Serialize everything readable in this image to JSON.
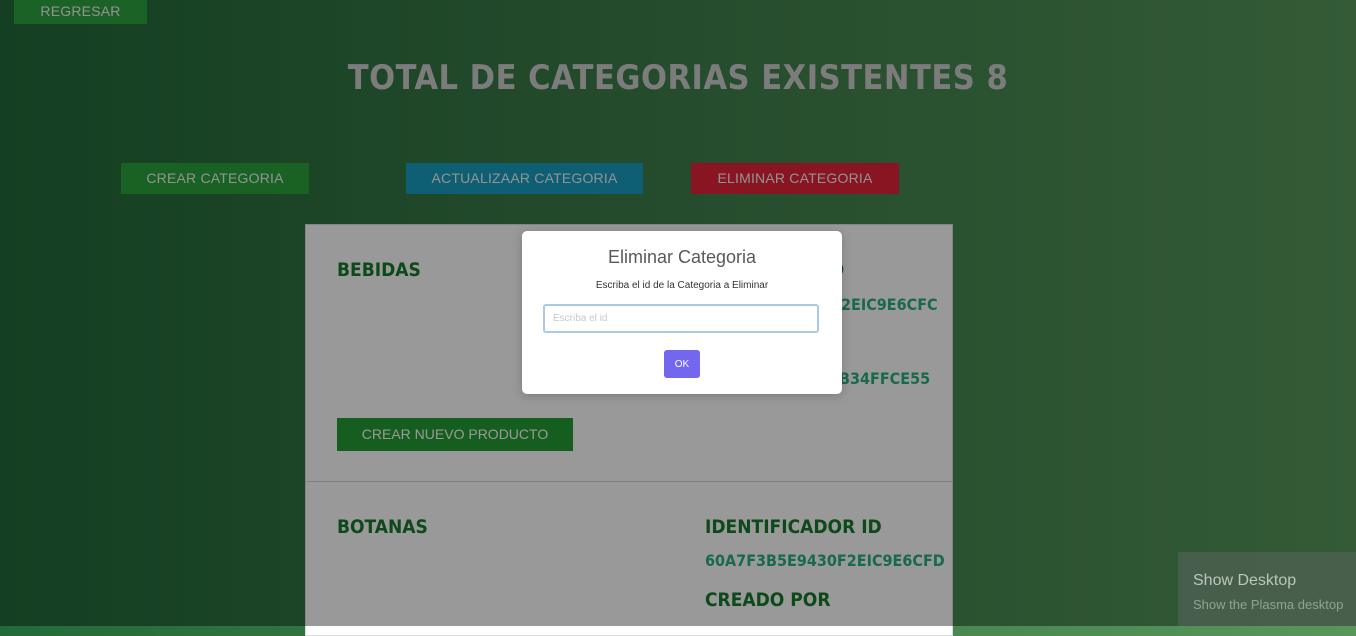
{
  "header": {
    "back_label": "REGRESAR",
    "title": "TOTAL DE CATEGORIAS EXISTENTES 8"
  },
  "actions": {
    "create_label": "CREAR CATEGORIA",
    "update_label": "ACTUALIZAAR CATEGORIA",
    "delete_label": "ELIMINAR CATEGORIA"
  },
  "categories": [
    {
      "name": "BEBIDAS",
      "id_label": "D",
      "id_value": "2EIC9E6CFC",
      "created_value": "B34FFCE55",
      "new_product_label": "CREAR NUEVO PRODUCTO"
    },
    {
      "name": "BOTANAS",
      "id_label": "IDENTIFICADOR ID",
      "id_value": "60A7F3B5E9430F2EIC9E6CFD",
      "created_label": "CREADO POR"
    }
  ],
  "modal": {
    "title": "Eliminar Categoria",
    "text": "Escriba el id de la Categoria a Eliminar",
    "input_placeholder": "Escriba el id",
    "input_value": "",
    "ok_label": "OK"
  },
  "tooltip": {
    "title": "Show Desktop",
    "subtitle": "Show the Plasma desktop"
  },
  "colors": {
    "create": "#2aa33c",
    "update": "#1a9fc2",
    "delete": "#e5243b",
    "ok": "#7367f0",
    "category_text": "#177a2a",
    "id_text": "#2ab07e"
  }
}
